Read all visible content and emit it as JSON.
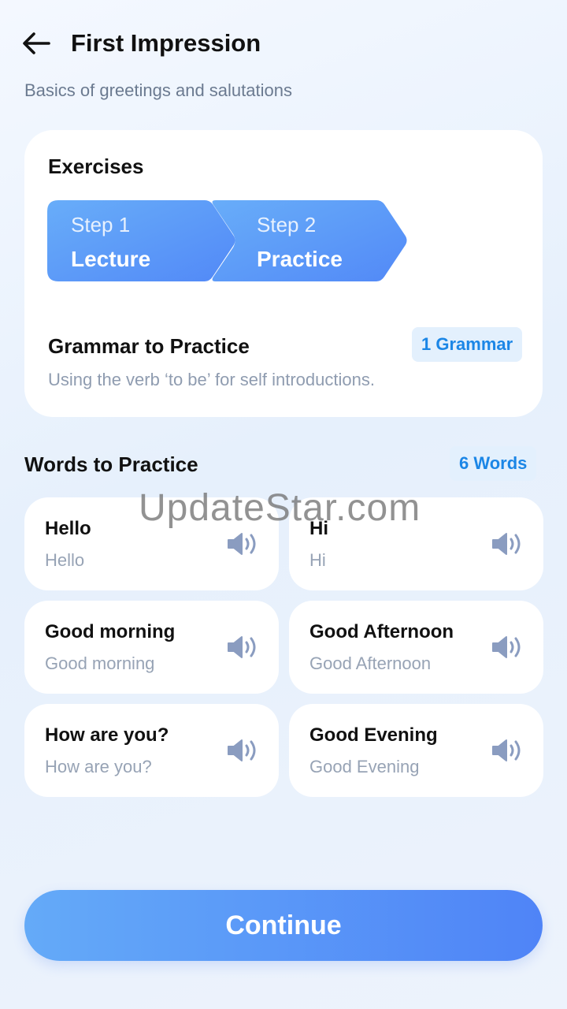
{
  "header": {
    "title": "First Impression",
    "subtitle": "Basics of greetings and salutations"
  },
  "exercises": {
    "title": "Exercises",
    "steps": [
      {
        "number": "Step 1",
        "name": "Lecture"
      },
      {
        "number": "Step 2",
        "name": "Practice"
      }
    ],
    "grammar_title": "Grammar to Practice",
    "grammar_badge": "1 Grammar",
    "grammar_desc": "Using the verb ‘to be’ for self introductions."
  },
  "words": {
    "title": "Words to Practice",
    "badge": "6 Words",
    "items": [
      {
        "word": "Hello",
        "translation": "Hello"
      },
      {
        "word": "Hi",
        "translation": "Hi"
      },
      {
        "word": "Good morning",
        "translation": "Good morning"
      },
      {
        "word": "Good Afternoon",
        "translation": "Good Afternoon"
      },
      {
        "word": "How are you?",
        "translation": "How are you?"
      },
      {
        "word": "Good Evening",
        "translation": "Good Evening"
      }
    ]
  },
  "continue_label": "Continue",
  "watermark": "UpdateStar.com",
  "colors": {
    "accent_start": "#64aaf8",
    "accent_end": "#4f84f7",
    "badge_text": "#1b86e6",
    "badge_bg": "#e3f0fd"
  },
  "icons": {
    "back": "arrow-left-icon",
    "speaker": "speaker-icon"
  }
}
